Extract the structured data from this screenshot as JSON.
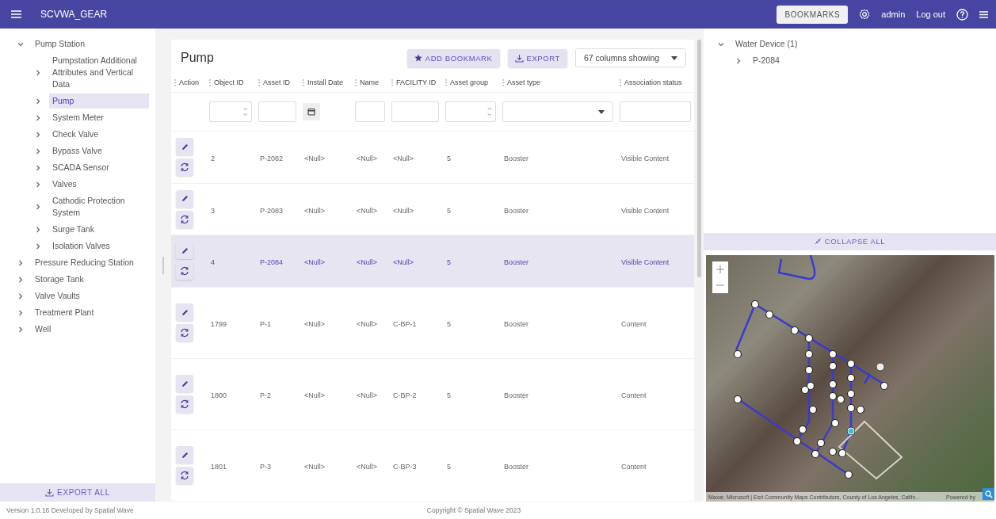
{
  "app_bar": {
    "title": "SCVWA_GEAR",
    "bookmarks_button": "BOOKMARKS",
    "user": "admin",
    "logout": "Log out"
  },
  "sidebar": {
    "tree": [
      {
        "label": "Pump Station",
        "expanded": true,
        "selected": false,
        "children": [
          {
            "label": "Pumpstation Additional Attributes and Vertical Data",
            "expanded": false,
            "selected": false
          },
          {
            "label": "Pump",
            "expanded": false,
            "selected": true
          },
          {
            "label": "System Meter",
            "expanded": false,
            "selected": false
          },
          {
            "label": "Check Valve",
            "expanded": false,
            "selected": false
          },
          {
            "label": "Bypass Valve",
            "expanded": false,
            "selected": false
          },
          {
            "label": "SCADA Sensor",
            "expanded": false,
            "selected": false
          },
          {
            "label": "Valves",
            "expanded": false,
            "selected": false
          },
          {
            "label": "Cathodic Protection System",
            "expanded": false,
            "selected": false
          },
          {
            "label": "Surge Tank",
            "expanded": false,
            "selected": false
          },
          {
            "label": "Isolation Valves",
            "expanded": false,
            "selected": false
          }
        ]
      },
      {
        "label": "Pressure Reducing Station",
        "expanded": false,
        "selected": false
      },
      {
        "label": "Storage Tank",
        "expanded": false,
        "selected": false
      },
      {
        "label": "Valve Vaults",
        "expanded": false,
        "selected": false
      },
      {
        "label": "Treatment Plant",
        "expanded": false,
        "selected": false
      },
      {
        "label": "Well",
        "expanded": false,
        "selected": false
      }
    ],
    "export_button": "EXPORT ALL"
  },
  "table_panel": {
    "title": "Pump",
    "add_bookmark_button": "ADD BOOKMARK",
    "export_button": "EXPORT",
    "columns_select": "67 columns showing",
    "action_column": "Action",
    "columns": [
      "Object ID",
      "Asset ID",
      "Install Date",
      "Name",
      "FACILITY ID",
      "Asset group",
      "Asset type",
      "Association status"
    ],
    "filters": [
      {
        "kind": "number"
      },
      {
        "kind": "text"
      },
      {
        "kind": "date"
      },
      {
        "kind": "text"
      },
      {
        "kind": "text"
      },
      {
        "kind": "number"
      },
      {
        "kind": "select"
      },
      {
        "kind": "text"
      }
    ],
    "rows": [
      {
        "cells": [
          "2",
          "P-2082",
          "<Null>",
          "<Null>",
          "<Null>",
          "5",
          "Booster",
          "Visible Content"
        ],
        "selected": false
      },
      {
        "cells": [
          "3",
          "P-2083",
          "<Null>",
          "<Null>",
          "<Null>",
          "5",
          "Booster",
          "Visible Content"
        ],
        "selected": false
      },
      {
        "cells": [
          "4",
          "P-2084",
          "<Null>",
          "<Null>",
          "<Null>",
          "5",
          "Booster",
          "Visible Content"
        ],
        "selected": true
      },
      {
        "cells": [
          "1799",
          "P-1",
          "<Null>",
          "<Null>",
          "C-BP-1",
          "5",
          "Booster",
          "Content"
        ],
        "selected": false
      },
      {
        "cells": [
          "1800",
          "P-2",
          "<Null>",
          "<Null>",
          "C-BP-2",
          "5",
          "Booster",
          "Content"
        ],
        "selected": false
      },
      {
        "cells": [
          "1801",
          "P-3",
          "<Null>",
          "<Null>",
          "C-BP-3",
          "5",
          "Booster",
          "Content"
        ],
        "selected": false
      }
    ]
  },
  "relations_panel": {
    "tree": [
      {
        "label": "Water Device (1)",
        "expanded": true,
        "children": [
          {
            "label": "P-2084",
            "expanded": false
          }
        ]
      }
    ],
    "collapse_button": "COLLAPSE ALL"
  },
  "map": {
    "attribution": "Maxar, Microsoft | Esri Community Maps Contributors, County of Los Angeles, Califo…",
    "powered_by": "Powered by"
  },
  "footer": {
    "version": "Version 1.0.16 Developed by Spatial Wave",
    "copyright": "Copyright © Spatial Wave 2023"
  }
}
